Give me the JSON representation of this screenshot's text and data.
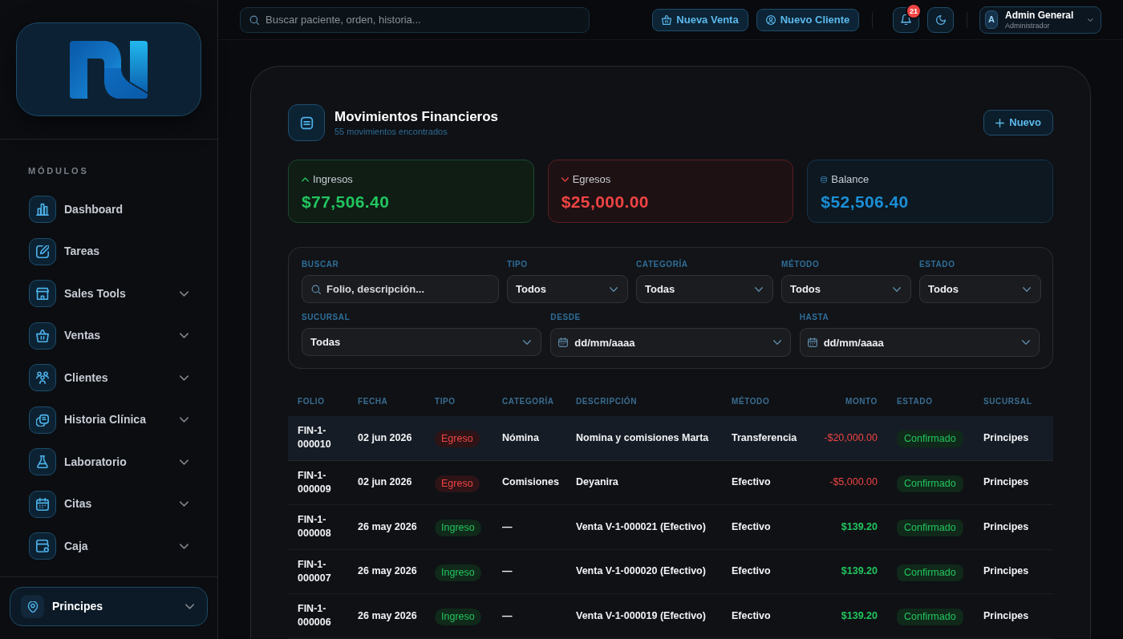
{
  "sidebar": {
    "section_label": "MÓDULOS",
    "items": [
      {
        "label": "Dashboard",
        "expandable": false
      },
      {
        "label": "Tareas",
        "expandable": false
      },
      {
        "label": "Sales Tools",
        "expandable": true
      },
      {
        "label": "Ventas",
        "expandable": true
      },
      {
        "label": "Clientes",
        "expandable": true
      },
      {
        "label": "Historia Clínica",
        "expandable": true
      },
      {
        "label": "Laboratorio",
        "expandable": true
      },
      {
        "label": "Citas",
        "expandable": true
      },
      {
        "label": "Caja",
        "expandable": true
      }
    ],
    "branch_selector": {
      "label": "Principes"
    }
  },
  "top_bar": {
    "search": {
      "placeholder": "Buscar paciente, orden, historia..."
    },
    "actions": [
      {
        "label": "Nueva Venta"
      },
      {
        "label": "Nuevo Cliente"
      }
    ],
    "notifications": {
      "count": "21"
    },
    "user": {
      "initial": "A",
      "name": "Admin General",
      "role": "Administrador"
    }
  },
  "page": {
    "title": "Movimientos Financieros",
    "subtitle": "55 movimientos encontrados",
    "new_button": "Nuevo",
    "stats": [
      {
        "kind": "income",
        "label": "Ingresos",
        "value": "$77,506.40"
      },
      {
        "kind": "expense",
        "label": "Egresos",
        "value": "$25,000.00"
      },
      {
        "kind": "balance",
        "label": "Balance",
        "value": "$52,506.40"
      }
    ],
    "filter_rows": [
      [
        {
          "kind": "search",
          "label": "BUSCAR",
          "placeholder": "Folio, descripción..."
        },
        {
          "kind": "select",
          "label": "TIPO",
          "value": "Todos"
        },
        {
          "kind": "select",
          "label": "CATEGORÍA",
          "value": "Todas"
        },
        {
          "kind": "select",
          "label": "MÉTODO",
          "value": "Todos"
        },
        {
          "kind": "select",
          "label": "ESTADO",
          "value": "Todos"
        }
      ],
      [
        {
          "kind": "select",
          "label": "SUCURSAL",
          "value": "Todas"
        },
        {
          "kind": "date",
          "label": "DESDE",
          "placeholder": "dd/mm/aaaa"
        },
        {
          "kind": "date",
          "label": "HASTA",
          "placeholder": "dd/mm/aaaa"
        }
      ]
    ],
    "table": {
      "columns": [
        "FOLIO",
        "FECHA",
        "TIPO",
        "CATEGORÍA",
        "DESCRIPCIÓN",
        "MÉTODO",
        "MONTO",
        "ESTADO",
        "SUCURSAL"
      ],
      "rows": [
        {
          "selected": true,
          "kind": "expense",
          "folio": "FIN-1-000010",
          "date": "02 jun 2026",
          "type": "Egreso",
          "category": "Nómina",
          "description": "Nomina y comisiones Marta",
          "method": "Transferencia",
          "amount": "-$20,000.00",
          "status": "Confirmado",
          "branch": "Principes"
        },
        {
          "selected": false,
          "kind": "expense",
          "folio": "FIN-1-000009",
          "date": "02 jun 2026",
          "type": "Egreso",
          "category": "Comisiones",
          "description": "Deyanira",
          "method": "Efectivo",
          "amount": "-$5,000.00",
          "status": "Confirmado",
          "branch": "Principes"
        },
        {
          "selected": false,
          "kind": "income",
          "folio": "FIN-1-000008",
          "date": "26 may 2026",
          "type": "Ingreso",
          "category": "—",
          "description": "Venta V-1-000021 (Efectivo)",
          "method": "Efectivo",
          "amount": "$139.20",
          "status": "Confirmado",
          "branch": "Principes"
        },
        {
          "selected": false,
          "kind": "income",
          "folio": "FIN-1-000007",
          "date": "26 may 2026",
          "type": "Ingreso",
          "category": "—",
          "description": "Venta V-1-000020 (Efectivo)",
          "method": "Efectivo",
          "amount": "$139.20",
          "status": "Confirmado",
          "branch": "Principes"
        },
        {
          "selected": false,
          "kind": "income",
          "folio": "FIN-1-000006",
          "date": "26 may 2026",
          "type": "Ingreso",
          "category": "—",
          "description": "Venta V-1-000019 (Efectivo)",
          "method": "Efectivo",
          "amount": "$139.20",
          "status": "Confirmado",
          "branch": "Principes"
        }
      ]
    }
  }
}
